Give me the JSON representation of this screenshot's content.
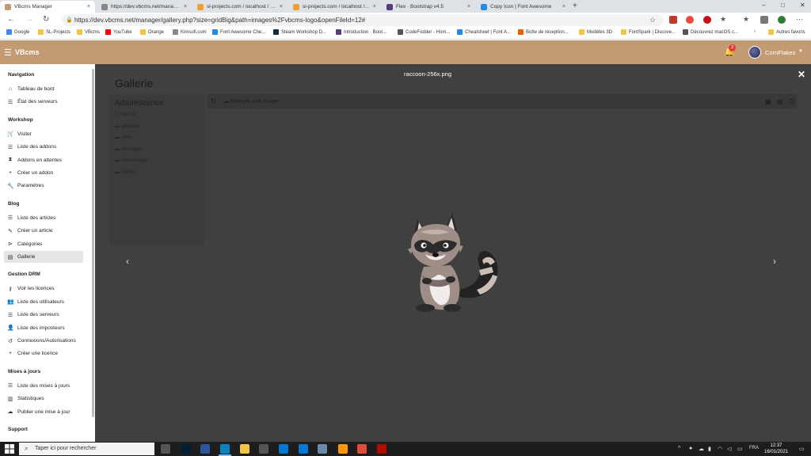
{
  "browser": {
    "tabs": [
      {
        "title": "VBcms Manager",
        "active": true,
        "favicon_color": "#c29a73"
      },
      {
        "title": "https://dev.vbcms.net/manager/...",
        "active": false,
        "favicon_color": "#888888"
      },
      {
        "title": "sl-projects.com / localhost / vbc",
        "active": false,
        "favicon_color": "#f0a030"
      },
      {
        "title": "sl-projects.com / localhost / vbc",
        "active": false,
        "favicon_color": "#f0a030"
      },
      {
        "title": "Flex · Bootstrap v4.5",
        "active": false,
        "favicon_color": "#563d7c"
      },
      {
        "title": "Copy Icon | Font Awesome",
        "active": false,
        "favicon_color": "#228be6"
      }
    ],
    "url": "https://dev.vbcms.net/manager/gallery.php?size=gridBig&path=images%2Fvbcms-logo&openFileId=12#",
    "bookmarks": [
      {
        "label": "Google",
        "color": "#4285f4"
      },
      {
        "label": "SL-Projects",
        "color": "#f4c542"
      },
      {
        "label": "VBcms",
        "color": "#f4c542"
      },
      {
        "label": "YouTube",
        "color": "#ff0000"
      },
      {
        "label": "Orange",
        "color": "#f4c542"
      },
      {
        "label": "Kimsufi.com",
        "color": "#888888"
      },
      {
        "label": "Font Awesome Che...",
        "color": "#228be6"
      },
      {
        "label": "Steam Workshop D...",
        "color": "#1b2838"
      },
      {
        "label": "Introduction · Boot...",
        "color": "#563d7c"
      },
      {
        "label": "CodeFodder - Hom...",
        "color": "#555555"
      },
      {
        "label": "Cheatsheet | Font A...",
        "color": "#228be6"
      },
      {
        "label": "Boîte de réception...",
        "color": "#e66000"
      },
      {
        "label": "Modèles 3D",
        "color": "#f4c542"
      },
      {
        "label": "FontSpark | Discove...",
        "color": "#f4c542"
      },
      {
        "label": "Découvrez macOS c...",
        "color": "#555555"
      }
    ],
    "other_bookmarks": "Autres favoris"
  },
  "app": {
    "brand": "VBcms",
    "notification_count": "3",
    "username": "CornFlakes"
  },
  "sidebar": {
    "sections": [
      {
        "title": "Navigation",
        "items": [
          {
            "label": "Tableau de bord",
            "icon": "home-icon",
            "glyph": "⌂"
          },
          {
            "label": "État des serveurs",
            "icon": "list-icon",
            "glyph": "☰"
          }
        ]
      },
      {
        "title": "Workshop",
        "items": [
          {
            "label": "Visiter",
            "icon": "cart-icon",
            "glyph": "🛒"
          },
          {
            "label": "Liste des addons",
            "icon": "list-icon",
            "glyph": "☰"
          },
          {
            "label": "Addons en attentes",
            "icon": "hourglass-icon",
            "glyph": "⧗"
          },
          {
            "label": "Créer un addon",
            "icon": "plus-icon",
            "glyph": "+"
          },
          {
            "label": "Paramètres",
            "icon": "wrench-icon",
            "glyph": "🔧"
          }
        ]
      },
      {
        "title": "Blog",
        "items": [
          {
            "label": "Liste des articles",
            "icon": "list-icon",
            "glyph": "☰"
          },
          {
            "label": "Créer un article",
            "icon": "pencil-icon",
            "glyph": "✎"
          },
          {
            "label": "Catégories",
            "icon": "tags-icon",
            "glyph": "⊳"
          },
          {
            "label": "Gallerie",
            "icon": "images-icon",
            "glyph": "▤",
            "active": true
          }
        ]
      },
      {
        "title": "Gestion DRM",
        "items": [
          {
            "label": "Voir les licences",
            "icon": "key-icon",
            "glyph": "⚷"
          },
          {
            "label": "Liste des utilisateurs",
            "icon": "users-icon",
            "glyph": "👥"
          },
          {
            "label": "Liste des serveurs",
            "icon": "list-icon",
            "glyph": "☰"
          },
          {
            "label": "Liste des imposteurs",
            "icon": "user-times-icon",
            "glyph": "👤"
          },
          {
            "label": "Connexions/Autorisations",
            "icon": "history-icon",
            "glyph": "↺"
          },
          {
            "label": "Créer une licence",
            "icon": "plus-icon",
            "glyph": "+"
          }
        ]
      },
      {
        "title": "Mises à jours",
        "items": [
          {
            "label": "Liste des mises à jours",
            "icon": "list-icon",
            "glyph": "☰"
          },
          {
            "label": "Statistiques",
            "icon": "chart-icon",
            "glyph": "▥"
          },
          {
            "label": "Publier une mise à jour",
            "icon": "cloud-upload-icon",
            "glyph": "☁"
          }
        ]
      },
      {
        "title": "Support",
        "items": []
      }
    ]
  },
  "main": {
    "title": "Gallerie",
    "tree": {
      "title": "Arborescence",
      "nodes": [
        {
          "label": "Racine",
          "glyph": "⌂"
        },
        {
          "label": "general",
          "glyph": "▬"
        },
        {
          "label": "pink",
          "glyph": "▬"
        },
        {
          "label": "manager",
          "glyph": "▬"
        },
        {
          "label": "vbcms-logo",
          "glyph": "▬"
        },
        {
          "label": "vbcms",
          "glyph": "▬"
        }
      ]
    },
    "toolbar": {
      "upload_label": "Envoyer une image"
    }
  },
  "lightbox": {
    "filename": "raccoon-256x.png",
    "image_name": "raccoon-image"
  },
  "taskbar": {
    "search_placeholder": "Taper ici pour rechercher",
    "apps": [
      {
        "name": "task-view-icon",
        "color": "#555555"
      },
      {
        "name": "photoshop-icon",
        "color": "#001e36"
      },
      {
        "name": "word-icon",
        "color": "#2b579a"
      },
      {
        "name": "edge-icon",
        "color": "#0a84c1"
      },
      {
        "name": "file-explorer-icon",
        "color": "#f4c542"
      },
      {
        "name": "store-icon",
        "color": "#555555"
      },
      {
        "name": "phone-icon",
        "color": "#0078d4"
      },
      {
        "name": "app-icon",
        "color": "#0078d4"
      },
      {
        "name": "photos-icon",
        "color": "#6a8aa8"
      },
      {
        "name": "sublime-icon",
        "color": "#ff9800"
      },
      {
        "name": "git-icon",
        "color": "#e04e39"
      },
      {
        "name": "acrobat-icon",
        "color": "#b30b00"
      }
    ],
    "language": "FRA",
    "time": "12:37",
    "date": "16/01/2021"
  }
}
